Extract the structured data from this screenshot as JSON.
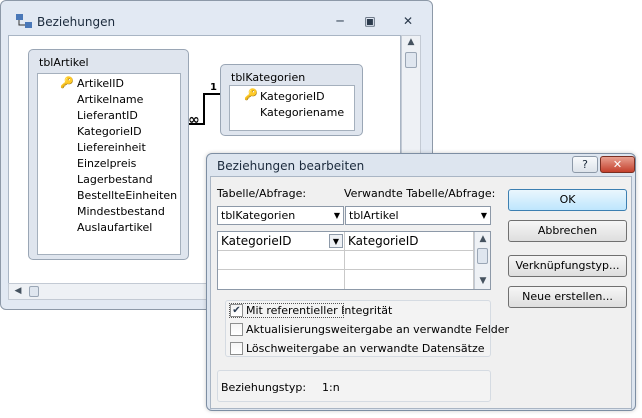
{
  "main_window": {
    "title": "Beziehungen",
    "minimize_glyph": "─",
    "restore_glyph": "▣",
    "close_glyph": "✕"
  },
  "tables": [
    {
      "name": "tblArtikel",
      "fields": [
        "ArtikelID",
        "Artikelname",
        "LieferantID",
        "KategorieID",
        "Liefereinheit",
        "Einzelpreis",
        "Lagerbestand",
        "BestellteEinheiten",
        "Mindestbestand",
        "Auslaufartikel"
      ],
      "key_field_index": 0
    },
    {
      "name": "tblKategorien",
      "fields": [
        "KategorieID",
        "Kategoriename"
      ],
      "key_field_index": 0
    }
  ],
  "relationship_line": {
    "one_label": "1",
    "many_label": "∞"
  },
  "dialog": {
    "title": "Beziehungen bearbeiten",
    "help_glyph": "?",
    "close_glyph": "✕",
    "table_query_label": "Tabelle/Abfrage:",
    "related_table_query_label": "Verwandte Tabelle/Abfrage:",
    "table_query_value": "tblKategorien",
    "related_table_query_value": "tblArtikel",
    "grid_rows": [
      {
        "left": "KategorieID",
        "right": "KategorieID"
      },
      {
        "left": "",
        "right": ""
      },
      {
        "left": "",
        "right": ""
      }
    ],
    "buttons": {
      "ok": "OK",
      "cancel": "Abbrechen",
      "join_type": "Verknüpfungstyp...",
      "create_new": "Neue erstellen..."
    },
    "checkboxes": [
      {
        "label": "Mit referentieller Integrität",
        "checked": true
      },
      {
        "label": "Aktualisierungsweitergabe an verwandte Felder",
        "checked": false
      },
      {
        "label": "Löschweitergabe an verwandte Datensätze",
        "checked": false
      }
    ],
    "relationship_type_label": "Beziehungstyp:",
    "relationship_type_value": "1:n"
  },
  "icons": {
    "key_icon": "🔑",
    "dropdown_arrow": "▼",
    "scroll_up": "▲",
    "scroll_down": "▼",
    "scroll_left": "◀",
    "check_mark": "✔"
  },
  "colors": {
    "window_frame": "#e2e9f3",
    "table_box": "#dfe5ee",
    "default_button": "#bee6fd",
    "close_button": "#c4402c"
  }
}
